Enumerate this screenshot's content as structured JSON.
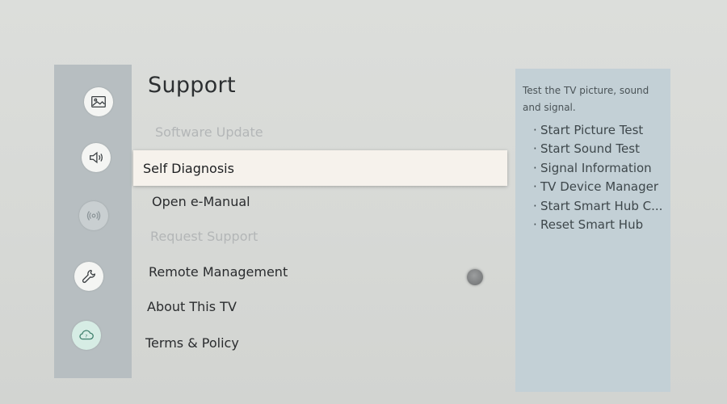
{
  "screen": {
    "title": "Support",
    "menu": [
      {
        "label": "Software Update",
        "state": "disabled"
      },
      {
        "label": "Self Diagnosis",
        "state": "selected"
      },
      {
        "label": "Open e-Manual",
        "state": "normal"
      },
      {
        "label": "Request Support",
        "state": "disabled"
      },
      {
        "label": "Remote Management",
        "state": "normal"
      },
      {
        "label": "About This TV",
        "state": "normal"
      },
      {
        "label": "Terms & Policy",
        "state": "normal"
      }
    ],
    "rail_icons": [
      "picture-icon",
      "sound-icon",
      "broadcast-icon",
      "wrench-icon",
      "support-cloud-icon"
    ]
  },
  "info_panel": {
    "description": "Test the TV picture, sound and signal.",
    "options": [
      "Start Picture Test",
      "Start Sound Test",
      "Signal Information",
      "TV Device Manager",
      "Start Smart Hub C...",
      "Reset Smart Hub"
    ]
  },
  "colors": {
    "rail": "#b7bec1",
    "panel": "#c3d0d6",
    "selected_row": "#f6f2ec",
    "disabled_text": "#b3b6b7"
  }
}
